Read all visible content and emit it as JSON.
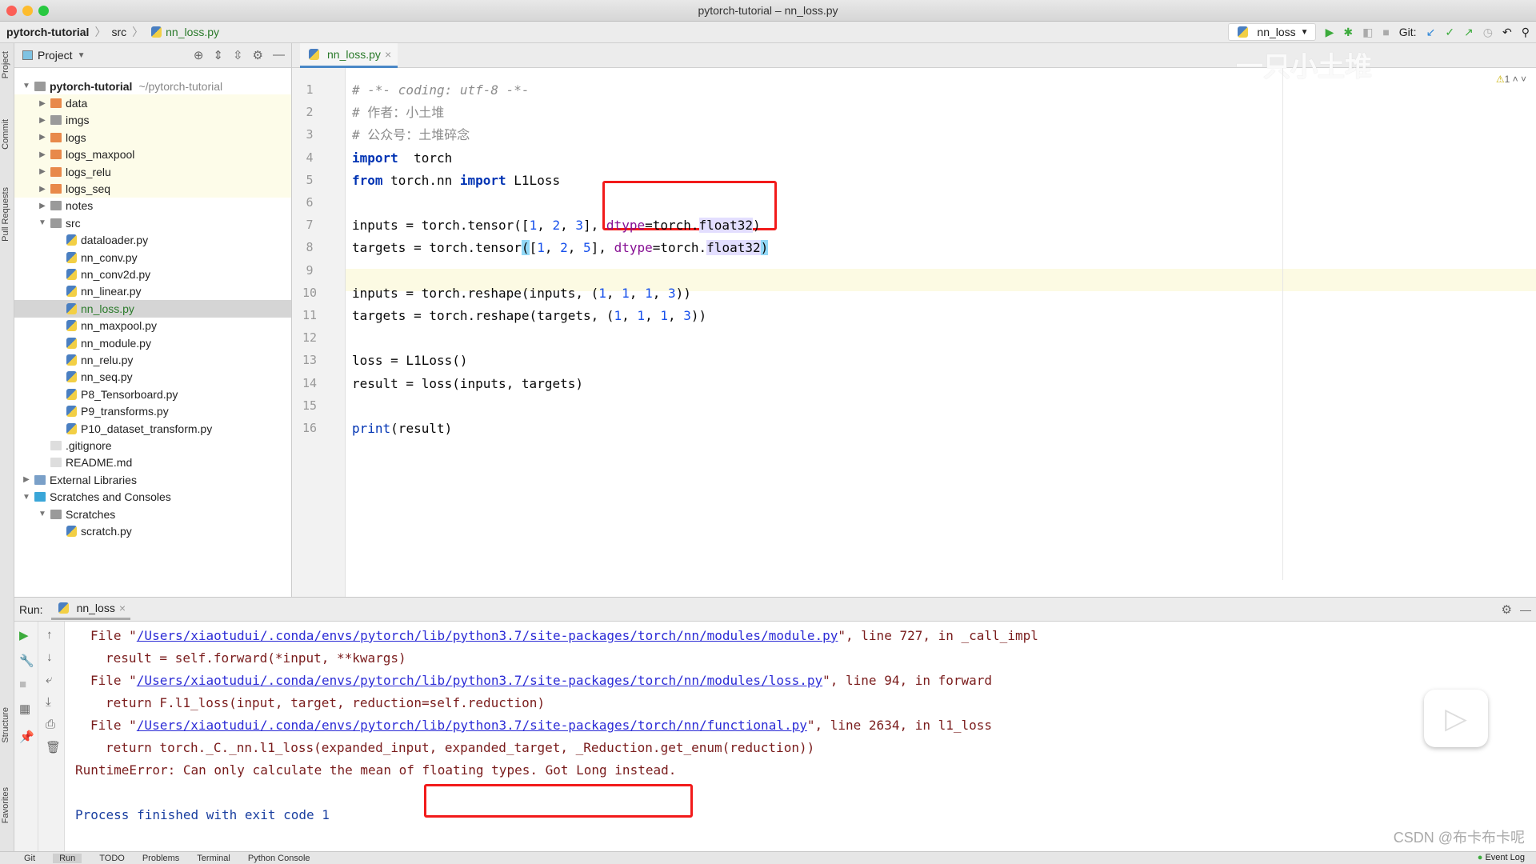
{
  "window": {
    "title": "pytorch-tutorial – nn_loss.py"
  },
  "breadcrumb": [
    "pytorch-tutorial",
    "src",
    "nn_loss.py"
  ],
  "toolbar": {
    "run_config": "nn_loss",
    "git_label": "Git:",
    "warnings": "1"
  },
  "side_labels": {
    "project": "Project",
    "commit": "Commit",
    "pull_requests": "Pull Requests",
    "structure": "Structure",
    "favorites": "Favorites"
  },
  "project": {
    "header": "Project",
    "tree": [
      {
        "label": "pytorch-tutorial",
        "hint": "~/pytorch-tutorial",
        "depth": 0,
        "kind": "folder-root",
        "open": true
      },
      {
        "label": "data",
        "depth": 1,
        "kind": "folder-orange",
        "open": false
      },
      {
        "label": "imgs",
        "depth": 1,
        "kind": "folder",
        "open": false
      },
      {
        "label": "logs",
        "depth": 1,
        "kind": "folder-orange",
        "open": false
      },
      {
        "label": "logs_maxpool",
        "depth": 1,
        "kind": "folder-orange",
        "open": false
      },
      {
        "label": "logs_relu",
        "depth": 1,
        "kind": "folder-orange",
        "open": false
      },
      {
        "label": "logs_seq",
        "depth": 1,
        "kind": "folder-orange",
        "open": false
      },
      {
        "label": "notes",
        "depth": 1,
        "kind": "folder",
        "open": false
      },
      {
        "label": "src",
        "depth": 1,
        "kind": "folder",
        "open": true
      },
      {
        "label": "dataloader.py",
        "depth": 2,
        "kind": "py"
      },
      {
        "label": "nn_conv.py",
        "depth": 2,
        "kind": "py"
      },
      {
        "label": "nn_conv2d.py",
        "depth": 2,
        "kind": "py"
      },
      {
        "label": "nn_linear.py",
        "depth": 2,
        "kind": "py"
      },
      {
        "label": "nn_loss.py",
        "depth": 2,
        "kind": "py",
        "selected": true
      },
      {
        "label": "nn_maxpool.py",
        "depth": 2,
        "kind": "py"
      },
      {
        "label": "nn_module.py",
        "depth": 2,
        "kind": "py"
      },
      {
        "label": "nn_relu.py",
        "depth": 2,
        "kind": "py"
      },
      {
        "label": "nn_seq.py",
        "depth": 2,
        "kind": "py"
      },
      {
        "label": "P8_Tensorboard.py",
        "depth": 2,
        "kind": "py"
      },
      {
        "label": "P9_transforms.py",
        "depth": 2,
        "kind": "py"
      },
      {
        "label": "P10_dataset_transform.py",
        "depth": 2,
        "kind": "py"
      },
      {
        "label": ".gitignore",
        "depth": 1,
        "kind": "file"
      },
      {
        "label": "README.md",
        "depth": 1,
        "kind": "file"
      },
      {
        "label": "External Libraries",
        "depth": 0,
        "kind": "lib",
        "open": false
      },
      {
        "label": "Scratches and Consoles",
        "depth": 0,
        "kind": "scratch",
        "open": true
      },
      {
        "label": "Scratches",
        "depth": 1,
        "kind": "folder",
        "open": true
      },
      {
        "label": "scratch.py",
        "depth": 2,
        "kind": "py"
      }
    ]
  },
  "editor": {
    "tab": "nn_loss.py",
    "lines": [
      [
        [
          "cm",
          "# -*- coding: utf-8 -*-"
        ]
      ],
      [
        [
          "cm2",
          "# 作者：小土堆"
        ]
      ],
      [
        [
          "cm2",
          "# 公众号：土堆碎念"
        ]
      ],
      [
        [
          "kw",
          "import"
        ],
        [
          "",
          "  torch"
        ]
      ],
      [
        [
          "kw",
          "from"
        ],
        [
          "",
          " torch.nn "
        ],
        [
          "kw",
          "import"
        ],
        [
          "",
          " L1Loss"
        ]
      ],
      [],
      [
        [
          "",
          "inputs = torch.tensor(["
        ],
        [
          "num",
          "1"
        ],
        [
          "",
          ", "
        ],
        [
          "num",
          "2"
        ],
        [
          "",
          ", "
        ],
        [
          "num",
          "3"
        ],
        [
          "",
          "], "
        ],
        [
          "prm",
          "dtype"
        ],
        [
          "",
          "=torch."
        ],
        [
          "sel2",
          "float32"
        ],
        [
          "",
          ")"
        ]
      ],
      [
        [
          "",
          "targets = torch.tensor"
        ],
        [
          "br",
          "("
        ],
        [
          "",
          "["
        ],
        [
          "num",
          "1"
        ],
        [
          "",
          ", "
        ],
        [
          "num",
          "2"
        ],
        [
          "",
          ", "
        ],
        [
          "num",
          "5"
        ],
        [
          "",
          "], "
        ],
        [
          "prm",
          "dtype"
        ],
        [
          "",
          "=torch."
        ],
        [
          "sel2",
          "float32"
        ],
        [
          "br",
          ")"
        ]
      ],
      [],
      [
        [
          "",
          "inputs = torch.reshape(inputs, ("
        ],
        [
          "num",
          "1"
        ],
        [
          "",
          ", "
        ],
        [
          "num",
          "1"
        ],
        [
          "",
          ", "
        ],
        [
          "num",
          "1"
        ],
        [
          "",
          ", "
        ],
        [
          "num",
          "3"
        ],
        [
          "",
          "))"
        ]
      ],
      [
        [
          "",
          "targets = torch.reshape(targets, ("
        ],
        [
          "num",
          "1"
        ],
        [
          "",
          ", "
        ],
        [
          "num",
          "1"
        ],
        [
          "",
          ", "
        ],
        [
          "num",
          "1"
        ],
        [
          "",
          ", "
        ],
        [
          "num",
          "3"
        ],
        [
          "",
          "))"
        ]
      ],
      [],
      [
        [
          "",
          "loss = L1Loss()"
        ]
      ],
      [
        [
          "",
          "result = loss(inputs, targets)"
        ]
      ],
      [],
      [
        [
          "bi",
          "print"
        ],
        [
          "",
          "(result)"
        ]
      ]
    ]
  },
  "run": {
    "label": "Run:",
    "tab": "nn_loss",
    "console": [
      {
        "indent": 1,
        "parts": [
          [
            "",
            "File \""
          ],
          [
            "lnk",
            "/Users/xiaotudui/.conda/envs/pytorch/lib/python3.7/site-packages/torch/nn/modules/module.py"
          ],
          [
            "",
            "\", line 727, in _call_impl"
          ]
        ]
      },
      {
        "indent": 2,
        "parts": [
          [
            "",
            "result = self.forward(*input, **kwargs)"
          ]
        ]
      },
      {
        "indent": 1,
        "parts": [
          [
            "",
            "File \""
          ],
          [
            "lnk",
            "/Users/xiaotudui/.conda/envs/pytorch/lib/python3.7/site-packages/torch/nn/modules/loss.py"
          ],
          [
            "",
            "\", line 94, in forward"
          ]
        ]
      },
      {
        "indent": 2,
        "parts": [
          [
            "",
            "return F.l1_loss(input, target, reduction=self.reduction)"
          ]
        ]
      },
      {
        "indent": 1,
        "parts": [
          [
            "",
            "File \""
          ],
          [
            "lnk",
            "/Users/xiaotudui/.conda/envs/pytorch/lib/python3.7/site-packages/torch/nn/functional.py"
          ],
          [
            "",
            "\", line 2634, in l1_loss"
          ]
        ]
      },
      {
        "indent": 2,
        "parts": [
          [
            "",
            "return torch._C._nn.l1_loss(expanded_input, expanded_target, _Reduction.get_enum(reduction))"
          ]
        ]
      },
      {
        "indent": 0,
        "parts": [
          [
            "",
            "RuntimeError: Can only calculate the mean of floating types. Got Long instead."
          ]
        ]
      },
      {
        "indent": 0,
        "parts": []
      },
      {
        "indent": 0,
        "parts": [
          [
            "blue",
            "Process finished with exit code 1"
          ]
        ]
      }
    ]
  },
  "statusbar": [
    "Git",
    "Run",
    "TODO",
    "Problems",
    "Terminal",
    "Python Console"
  ],
  "event_log": "Event Log",
  "watermarks": {
    "top": "一只小土堆",
    "bottom": "CSDN @布卡布卡呢"
  },
  "colors": {
    "highlight_box": "#f21b1b",
    "keyword": "#0033b3",
    "number": "#1750eb",
    "error_text": "#7a1c1c",
    "link": "#2c2cd6"
  }
}
